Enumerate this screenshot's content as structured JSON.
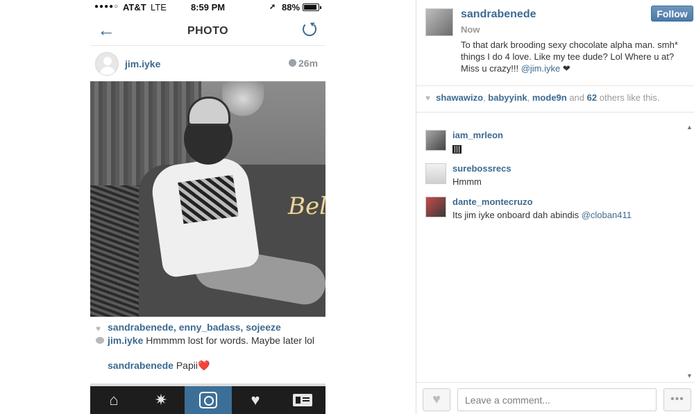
{
  "phone": {
    "status": {
      "signal": "●●●●○",
      "carrier": "AT&T",
      "network": "LTE",
      "time": "8:59 PM",
      "battery": "88%"
    },
    "nav": {
      "title": "PHOTO"
    },
    "post": {
      "username": "jim.iyke",
      "age": "26m",
      "watermark": "BellaNaija",
      "likes": "sandrabenede, enny_badass, sojeeze",
      "caption_user": "jim.iyke",
      "caption_text": " Hmmmm lost for words. Maybe later lol",
      "comment_user": "sandrabenede",
      "comment_text": " Papii",
      "comment_emoji": "❤️"
    },
    "tabs": [
      {
        "name": "home-tab"
      },
      {
        "name": "explore-tab"
      },
      {
        "name": "camera-tab"
      },
      {
        "name": "activity-tab"
      },
      {
        "name": "profile-tab"
      }
    ]
  },
  "panel": {
    "owner": "sandrabenede",
    "time": "Now",
    "follow_label": "Follow",
    "text": "To that dark brooding sexy chocolate alpha man. smh* things I do 4 love. Like my tee dude? Lol Where u at? Miss u crazy!!! ",
    "text_mention": "@jim.iyke",
    "text_suffix": " ❤",
    "likes": {
      "user1": "shawawizo",
      "sep1": ", ",
      "user2": "babyyink",
      "sep2": ", ",
      "user3": "mode9n",
      "and": " and ",
      "count": "62",
      "rest": " others like this."
    },
    "comments": [
      {
        "user": "iam_mrleon",
        "text": ""
      },
      {
        "user": "surebossrecs",
        "text": "Hmmm"
      },
      {
        "user": "dante_montecruzo",
        "text": "Its jim iyke onboard dah abindis ",
        "mention": "@cloban411"
      }
    ],
    "comment_placeholder": "Leave a comment...",
    "more_label": "•••"
  }
}
